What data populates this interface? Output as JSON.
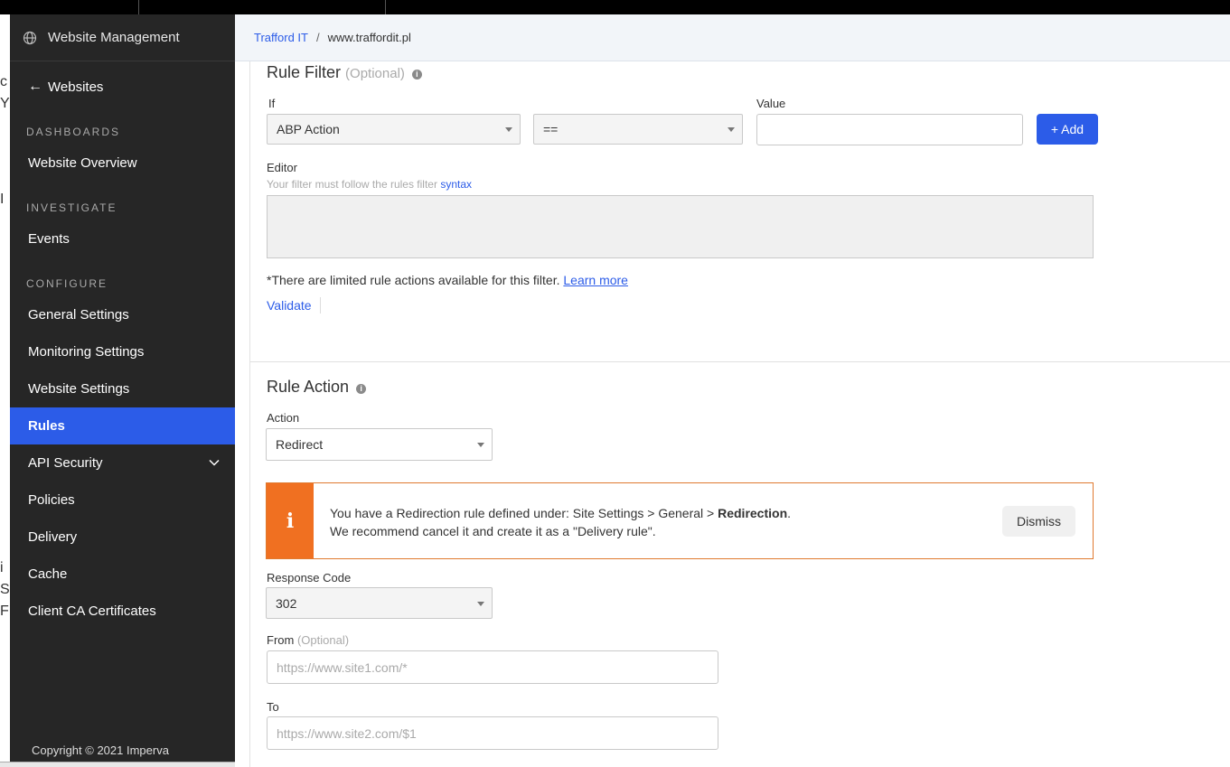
{
  "sidebar": {
    "header": "Website Management",
    "back": "Websites",
    "sections": {
      "dashboards": "DASHBOARDS",
      "investigate": "INVESTIGATE",
      "configure": "CONFIGURE"
    },
    "items": {
      "website_overview": "Website Overview",
      "events": "Events",
      "general_settings": "General Settings",
      "monitoring_settings": "Monitoring Settings",
      "website_settings": "Website Settings",
      "rules": "Rules",
      "api_security": "API Security",
      "policies": "Policies",
      "delivery": "Delivery",
      "cache": "Cache",
      "client_ca_certificates": "Client CA Certificates"
    },
    "active_item": "Rules",
    "copyright": "Copyright © 2021 Imperva"
  },
  "breadcrumb": {
    "account": "Trafford IT",
    "separator": "/",
    "site": "www.traffordit.pl"
  },
  "rule_filter": {
    "title": "Rule Filter",
    "optional": "(Optional)",
    "if_label": "If",
    "if_value": "ABP Action",
    "operator_value": "==",
    "value_label": "Value",
    "value_input": "",
    "add_button": "+ Add",
    "editor_label": "Editor",
    "editor_hint": "Your filter must follow the rules filter",
    "editor_hint_link": "syntax",
    "note": "*There are limited rule actions available for this filter.",
    "note_link": "Learn more",
    "validate": "Validate"
  },
  "rule_action": {
    "title": "Rule Action",
    "action_label": "Action",
    "action_value": "Redirect",
    "alert": {
      "line1_prefix": "You have a Redirection rule defined under: Site Settings > General >",
      "line1_bold": "Redirection",
      "line1_suffix": ".",
      "line2": "We recommend cancel it and create it as a \"Delivery rule\".",
      "dismiss": "Dismiss",
      "icon_glyph": "i"
    },
    "response_code_label": "Response Code",
    "response_code_value": "302",
    "from_label": "From",
    "from_optional": "(Optional)",
    "from_placeholder": "https://www.site1.com/*",
    "to_label": "To",
    "to_placeholder": "https://www.site2.com/$1"
  },
  "underlying_fragments": [
    "c",
    "Y",
    "I",
    "i",
    "S",
    "F"
  ],
  "colors": {
    "sidebar_bg": "#262626",
    "accent": "#2c5ce8",
    "alert_orange": "#f07021"
  },
  "icons": {
    "globe": "globe-icon",
    "back": "arrow-left-icon",
    "chevron": "chevron-down-icon",
    "info": "info-icon",
    "alert": "info-alert-icon"
  }
}
